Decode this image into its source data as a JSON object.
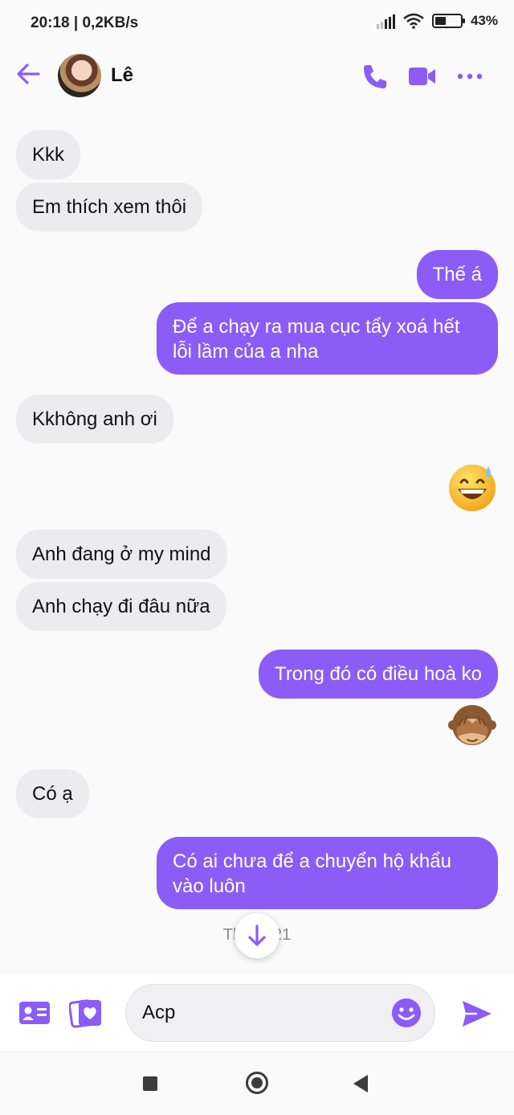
{
  "status_bar": {
    "time": "20:18 | 0,2KB/s",
    "battery": "43%"
  },
  "header": {
    "contact_name": "Lê",
    "icons": [
      "back-arrow-icon",
      "phone-icon",
      "video-camera-icon",
      "more-dots-icon"
    ]
  },
  "colors": {
    "accent": "#8b5cf6",
    "incoming_bubble": "#ececef",
    "outgoing_text": "#ffffff"
  },
  "messages": [
    {
      "from": "them",
      "text": "Kkk"
    },
    {
      "from": "them",
      "text": "Em thích xem thôi"
    },
    {
      "from": "me",
      "text": "Thế á"
    },
    {
      "from": "me",
      "text": "Để a chạy ra mua cục tẩy xoá hết lỗi lầm của a nha"
    },
    {
      "from": "them",
      "text": "Kkhông anh ơi"
    },
    {
      "from": "me",
      "emoji": "grinning-sweat-emoji"
    },
    {
      "from": "them",
      "text": "Anh đang ở my mind"
    },
    {
      "from": "them",
      "text": "Anh chạy đi đâu nữa"
    },
    {
      "from": "me",
      "text": "Trong đó có điều hoà ko"
    },
    {
      "from": "me",
      "emoji": "see-no-evil-monkey-emoji"
    },
    {
      "from": "them",
      "text": "Có ạ"
    },
    {
      "from": "me",
      "text": "Có ai chưa để a chuyển hộ khẩu vào luôn"
    }
  ],
  "timestamp": "Th 2      5:21",
  "composer": {
    "input_value": "Acp",
    "icons": [
      "contact-card-icon",
      "photo-stack-icon",
      "emoji-icon",
      "send-icon"
    ]
  }
}
